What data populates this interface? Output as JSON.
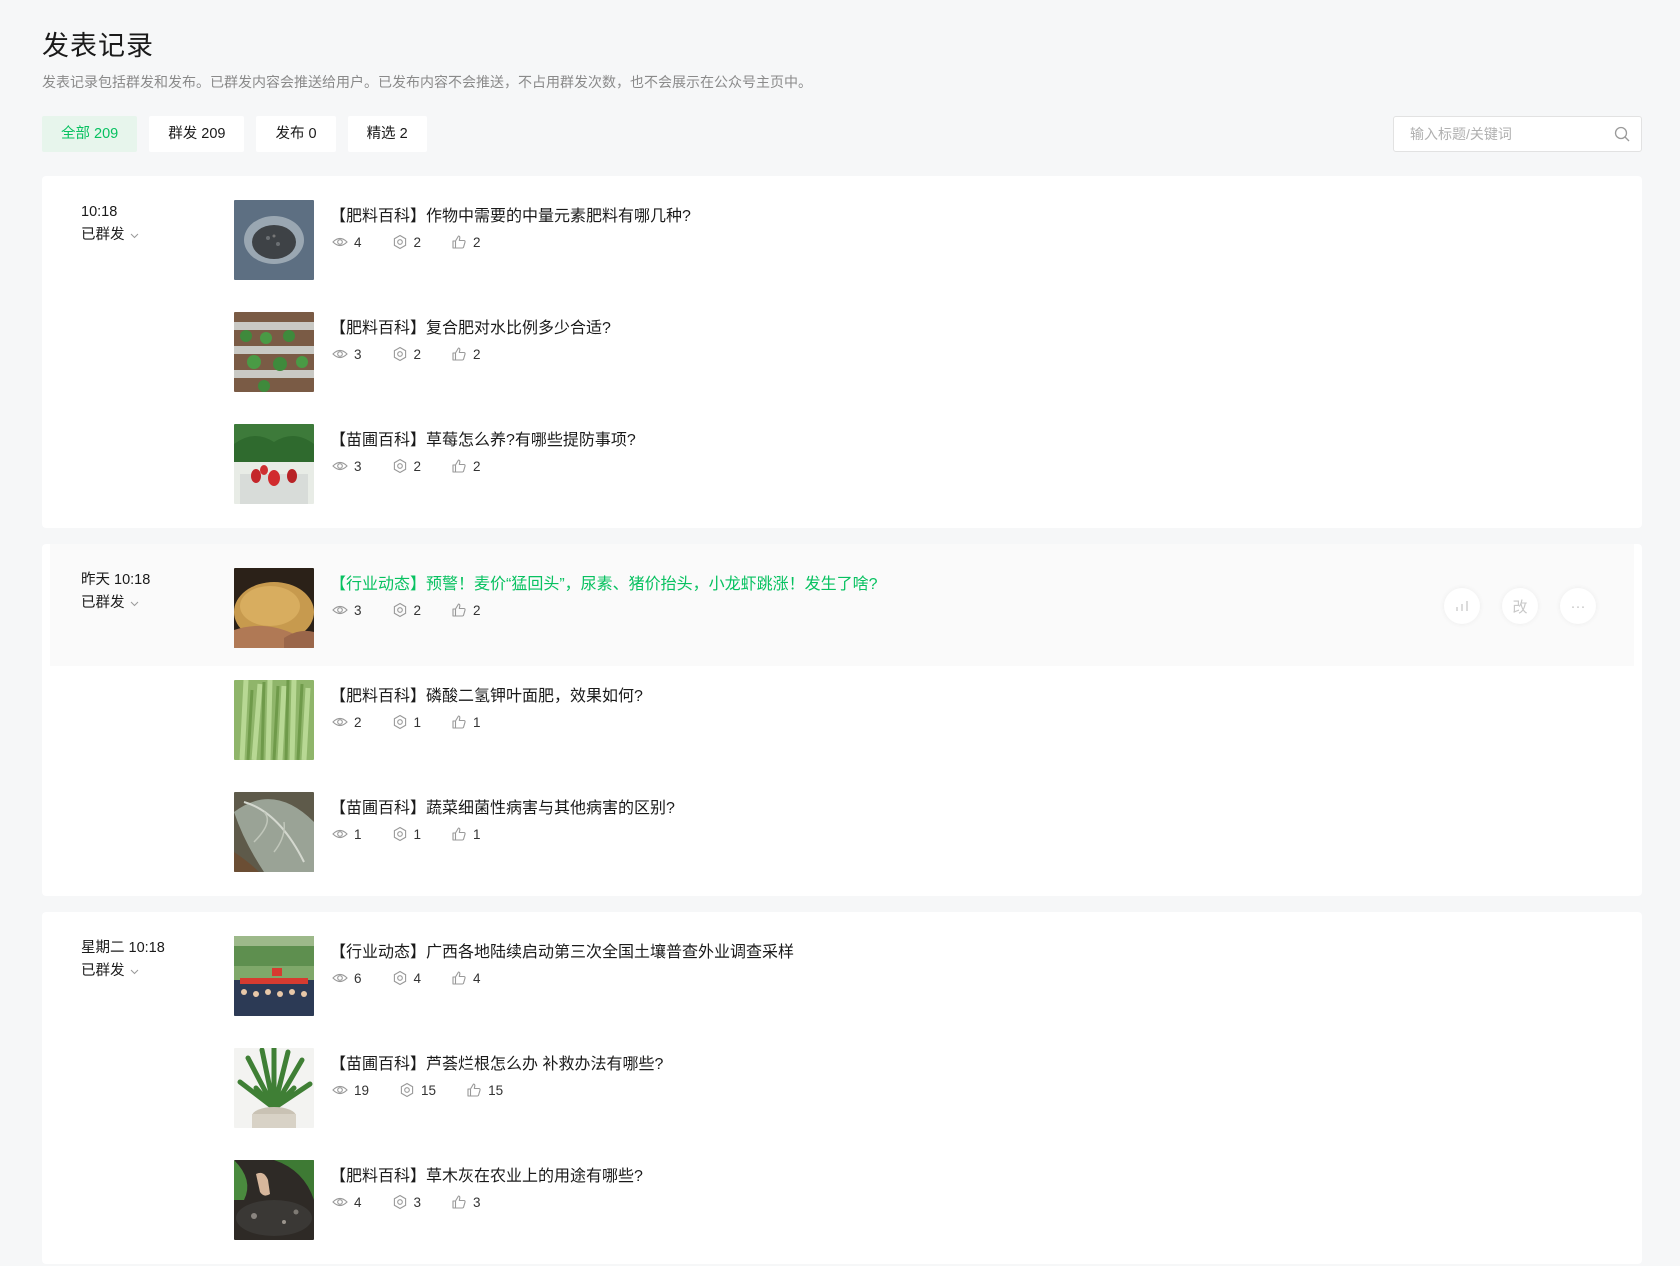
{
  "header": {
    "title": "发表记录",
    "description": "发表记录包括群发和发布。已群发内容会推送给用户。已发布内容不会推送，不占用群发次数，也不会展示在公众号主页中。"
  },
  "tabs": [
    {
      "label": "全部 209",
      "active": true
    },
    {
      "label": "群发 209",
      "active": false
    },
    {
      "label": "发布 0",
      "active": false
    },
    {
      "label": "精选 2",
      "active": false
    }
  ],
  "search": {
    "placeholder": "输入标题/关键词",
    "icon": "search-icon"
  },
  "colors": {
    "accent": "#07c160",
    "accent_bg": "#e7f5ec",
    "page_bg": "#f6f7f8"
  },
  "actions": {
    "stats_icon": "bar-chart-icon",
    "edit_label": "改",
    "more_label": "···"
  },
  "groups": [
    {
      "time": "10:18",
      "status": "已群发",
      "articles": [
        {
          "title": "【肥料百科】作物中需要的中量元素肥料有哪几种?",
          "views": "4",
          "shares": "2",
          "likes": "2",
          "thumb": "fertilizer-pellets"
        },
        {
          "title": "【肥料百科】复合肥对水比例多少合适?",
          "views": "3",
          "shares": "2",
          "likes": "2",
          "thumb": "seedlings-rows"
        },
        {
          "title": "【苗圃百科】草莓怎么养?有哪些提防事项?",
          "views": "3",
          "shares": "2",
          "likes": "2",
          "thumb": "strawberries"
        }
      ]
    },
    {
      "time": "昨天 10:18",
      "status": "已群发",
      "articles": [
        {
          "title": "【行业动态】预警！麦价“猛回头”，尿素、猪价抬头，小龙虾跳涨！发生了啥?",
          "views": "3",
          "shares": "2",
          "likes": "2",
          "thumb": "wheat-grain",
          "hover": true
        },
        {
          "title": "【肥料百科】磷酸二氢钾叶面肥，效果如何?",
          "views": "2",
          "shares": "1",
          "likes": "1",
          "thumb": "green-wheat"
        },
        {
          "title": "【苗圃百科】蔬菜细菌性病害与其他病害的区别?",
          "views": "1",
          "shares": "1",
          "likes": "1",
          "thumb": "cabbage-leaf"
        }
      ]
    },
    {
      "time": "星期二 10:18",
      "status": "已群发",
      "articles": [
        {
          "title": "【行业动态】广西各地陆续启动第三次全国土壤普查外业调查采样",
          "views": "6",
          "shares": "4",
          "likes": "4",
          "thumb": "field-group"
        },
        {
          "title": "【苗圃百科】芦荟烂根怎么办 补救办法有哪些?",
          "views": "19",
          "shares": "15",
          "likes": "15",
          "thumb": "aloe-plant"
        },
        {
          "title": "【肥料百科】草木灰在农业上的用途有哪些?",
          "views": "4",
          "shares": "3",
          "likes": "3",
          "thumb": "ash-soil"
        }
      ]
    }
  ]
}
